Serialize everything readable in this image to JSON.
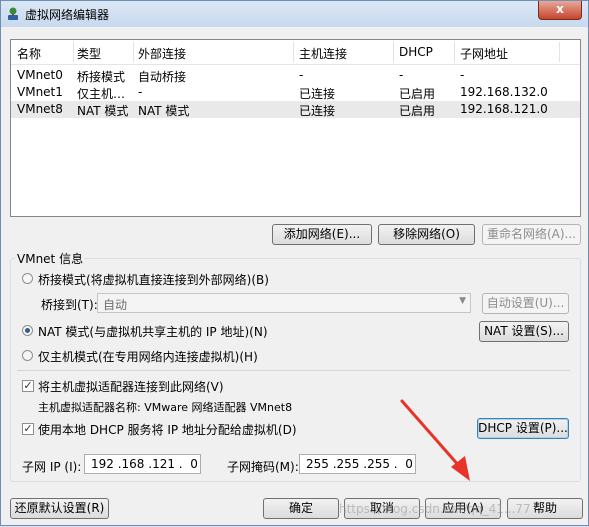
{
  "window": {
    "title": "虚拟网络编辑器",
    "close_label": "x"
  },
  "table": {
    "headers": [
      "名称",
      "类型",
      "外部连接",
      "主机连接",
      "DHCP",
      "子网地址"
    ],
    "rows": [
      [
        "VMnet0",
        "桥接模式",
        "自动桥接",
        "-",
        "-",
        "-"
      ],
      [
        "VMnet1",
        "仅主机…",
        "-",
        "已连接",
        "已启用",
        "192.168.132.0"
      ],
      [
        "VMnet8",
        "NAT 模式",
        "NAT 模式",
        "已连接",
        "已启用",
        "192.168.121.0"
      ]
    ],
    "selected_row": 2
  },
  "table_buttons": {
    "add": "添加网络(E)...",
    "remove": "移除网络(O)",
    "rename": "重命名网络(A)..."
  },
  "vmnet_info": {
    "label": "VMnet 信息",
    "bridge_radio": "桥接模式(将虚拟机直接连接到外部网络)(B)",
    "bridge_to_label": "桥接到(T):",
    "bridge_to_value": "自动",
    "auto_settings": "自动设置(U)...",
    "nat_radio": "NAT 模式(与虚拟机共享主机的 IP 地址)(N)",
    "nat_settings": "NAT 设置(S)...",
    "hostonly_radio": "仅主机模式(在专用网络内连接虚拟机)(H)",
    "selected_mode": "nat",
    "connect_adapter": "将主机虚拟适配器连接到此网络(V)",
    "connect_adapter_checked": true,
    "adapter_name_label": "主机虚拟适配器名称: VMware 网络适配器 VMnet8",
    "use_dhcp": "使用本地 DHCP 服务将 IP 地址分配给虚拟机(D)",
    "use_dhcp_checked": true,
    "dhcp_settings": "DHCP 设置(P)...",
    "subnet_ip_label": "子网 IP (I):",
    "subnet_ip_value": "192 .168 .121 .  0",
    "subnet_mask_label": "子网掩码(M):",
    "subnet_mask_value": "255 .255 .255 .  0"
  },
  "footer": {
    "restore": "还原默认设置(R)",
    "ok": "确定",
    "cancel": "取消",
    "apply": "应用(A)",
    "help": "帮助"
  },
  "watermark": "https://blog.csdn.net/qq_41...77",
  "colors": {
    "annotation_arrow": "#e8332a",
    "selected_row": "#e9e9e9"
  }
}
